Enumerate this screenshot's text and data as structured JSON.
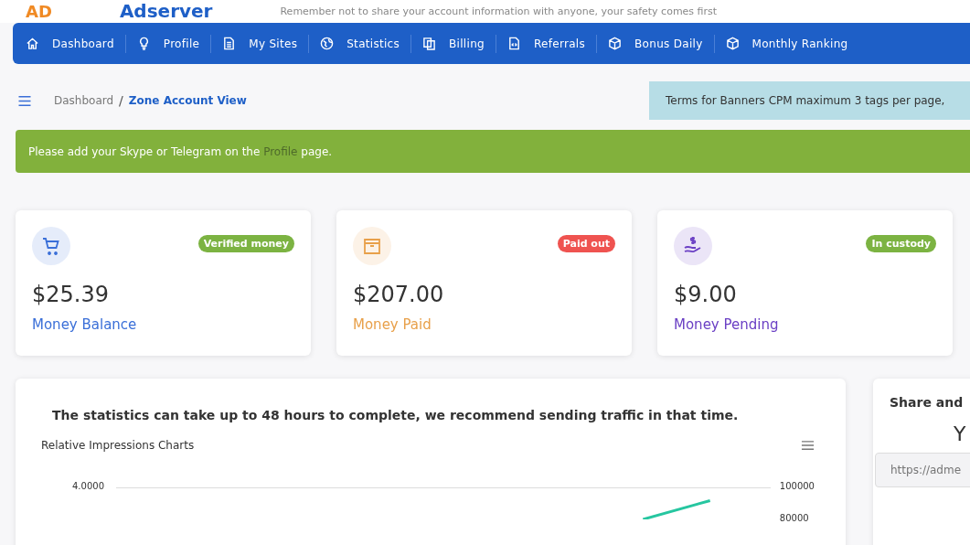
{
  "header": {
    "logo_mark": "AD",
    "brand": "Adserver",
    "notice": "Remember not to share your account information with anyone, your safety comes first"
  },
  "nav": [
    {
      "label": "Dashboard",
      "kind": "home"
    },
    {
      "label": "Profile",
      "kind": "bulb"
    },
    {
      "label": "My Sites",
      "kind": "doc"
    },
    {
      "label": "Statistics",
      "kind": "globe"
    },
    {
      "label": "Billing",
      "kind": "copy"
    },
    {
      "label": "Referrals",
      "kind": "filecode"
    },
    {
      "label": "Bonus Daily",
      "kind": "cube"
    },
    {
      "label": "Monthly Ranking",
      "kind": "cube"
    }
  ],
  "breadcrumb": [
    {
      "label": "Dashboard",
      "current": false
    },
    {
      "label": "Zone Account View",
      "current": true
    }
  ],
  "breadcrumb_separator": "/",
  "terms": "Terms for Banners CPM maximum 3 tags per page,",
  "alert": {
    "before": "Please add your Skype or Telegram on the",
    "link": "Profile",
    "after": "page."
  },
  "cards": [
    {
      "kind": "cart",
      "badge": {
        "text": "Verified money",
        "color": "#7cb342"
      },
      "amount": "$25.39",
      "label": "Money Balance",
      "color": "#3a6fd8"
    },
    {
      "kind": "box",
      "badge": {
        "text": "Paid out",
        "color": "#ef5350"
      },
      "amount": "$207.00",
      "label": "Money Paid",
      "color": "#e8a04a"
    },
    {
      "kind": "hand",
      "badge": {
        "text": "In custody",
        "color": "#7cb342"
      },
      "amount": "$9.00",
      "label": "Money Pending",
      "color": "#6a3fc4"
    }
  ],
  "stats": {
    "note": "The statistics can take up to 48 hours to complete, we recommend sending traffic in that time.",
    "chart_title": "Relative Impressions Charts",
    "left_tick": "4.0000",
    "right_ticks": [
      "100000",
      "80000"
    ]
  },
  "share": {
    "title": "Share and",
    "subtitle": "Y",
    "placeholder": "https://adme"
  }
}
